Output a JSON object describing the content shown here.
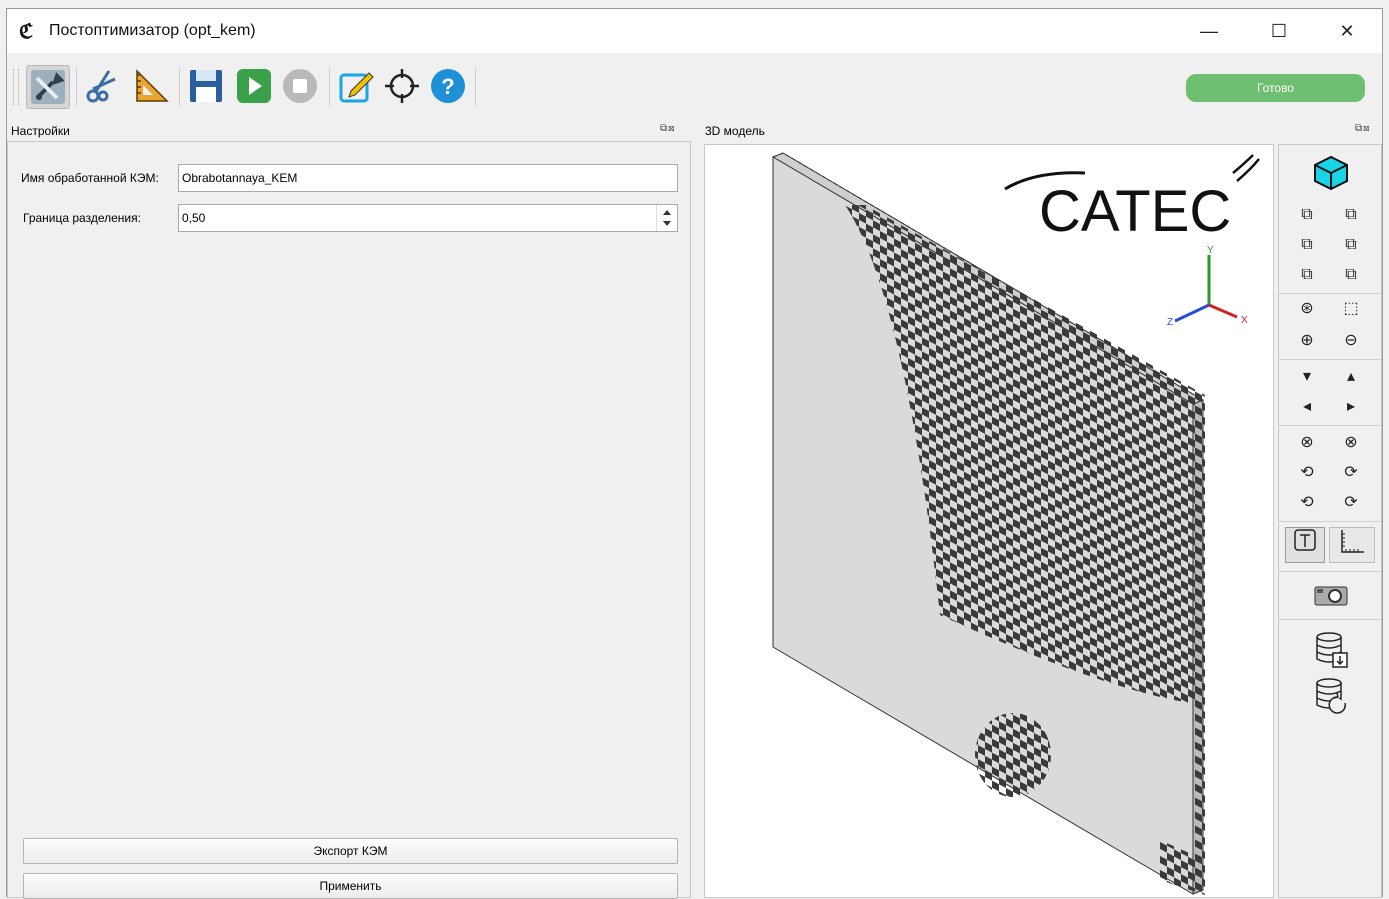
{
  "window": {
    "title": "Постоптимизатор (opt_kem)",
    "minimize": "—",
    "maximize": "☐",
    "close": "✕"
  },
  "toolbar": {
    "status": "Готово"
  },
  "settings": {
    "title": "Настройки",
    "name_label": "Имя обработанной КЭМ:",
    "name_value": "Obrabotannaya_KEM",
    "boundary_label": "Граница разделения:",
    "boundary_value": "0,50",
    "export_button": "Экспорт КЭМ",
    "apply_button": "Применить"
  },
  "model": {
    "title": "3D модель",
    "logo": "CATEC",
    "axis_x": "X",
    "axis_y": "Y",
    "axis_z": "Z"
  },
  "colors": {
    "status_bg": "#6fbf73",
    "plate": "#dadada",
    "cells": "#3a3a3a",
    "accent_cyan": "#19d3e6"
  }
}
